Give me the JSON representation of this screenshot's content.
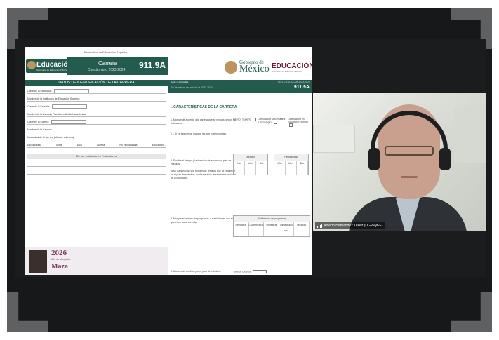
{
  "docA": {
    "logo_text": "Educación",
    "logo_sub": "Secretaría de Educación Pública",
    "header_small": "Estadística de Educación Superior",
    "title": "Carrera",
    "subtitle": "Cuestionario 2023-2024",
    "form_number": "911.9A",
    "section_title": "DATOS DE IDENTIFICACIÓN DE LA CARRERA",
    "fields": [
      "Clave de la Institución:",
      "Nombre de la Institución de Educación Superior:",
      "Clave de la Escuela:",
      "Nombre de la Escuela, Facultad o Unidad Académica:",
      "Clave de la Carrera:",
      "Nombre de la Carrera:",
      "Modalidad de la carrera (Marque solo una):"
    ],
    "modalidades": [
      "Escolarizada",
      "Mixta",
      "Dual",
      "Abierta",
      "No escolarizada",
      "Educación..."
    ],
    "section2": "De las Instituciones Particulares",
    "year": "2026",
    "year_sub": "Año de Margarita",
    "year_name": "Maza"
  },
  "docB": {
    "gob1": "Gobierno de",
    "gob2": "México",
    "edu": "EDUCACIÓN",
    "edu_sub": "Secretaría de Educación Pública",
    "bar_l1": "POR CARRERA",
    "bar_l2": "Fin de cursos del año de la 2023-2024",
    "bar_r1": "CICLO ESCOLAR 2023-2024",
    "bar_r2": "911.9A",
    "section": "I. CARACTERÍSTICAS DE LA CARRERA",
    "q1": "1. Marque de acuerdo a la carrera que se reporta, según su naturaleza:",
    "q1_opts": [
      "Técnico Superior",
      "Licenciatura Universitaria y Tecnológica",
      "Licenciatura en Educación Normal"
    ],
    "q1b": "1.1 Si es Ingeniería, marque las que correspondan:",
    "q2": "2. Escriba el tiempo y la duración de acuerdo al plan de estudios.",
    "q2b": "Nota: La duración y el número de créditos que se requieren en el plan de estudios, conforme a los lineamientos oficiales de la institución.",
    "table1_title": "Duración",
    "table2_title": "Periodicidad",
    "table_cols": [
      "Año",
      "Mes",
      "Día",
      "Año",
      "Mes",
      "Día"
    ],
    "q3": "3. Marque el número de programas o subsistemas con el que el personal acredita.",
    "table3_title": "Estudiantes",
    "table3_sub": "Distribución de programas",
    "table3_cols": [
      "Semestral",
      "Cuatrimestral",
      "Trimestral",
      "Bimestral u otra",
      "Modular"
    ],
    "q4": "4. Número de créditos por el plan de estudios:",
    "q4_right": "Total de créditos:"
  },
  "cam": {
    "name": "Alberto Hernández Téllez (DGPPyEE)"
  }
}
